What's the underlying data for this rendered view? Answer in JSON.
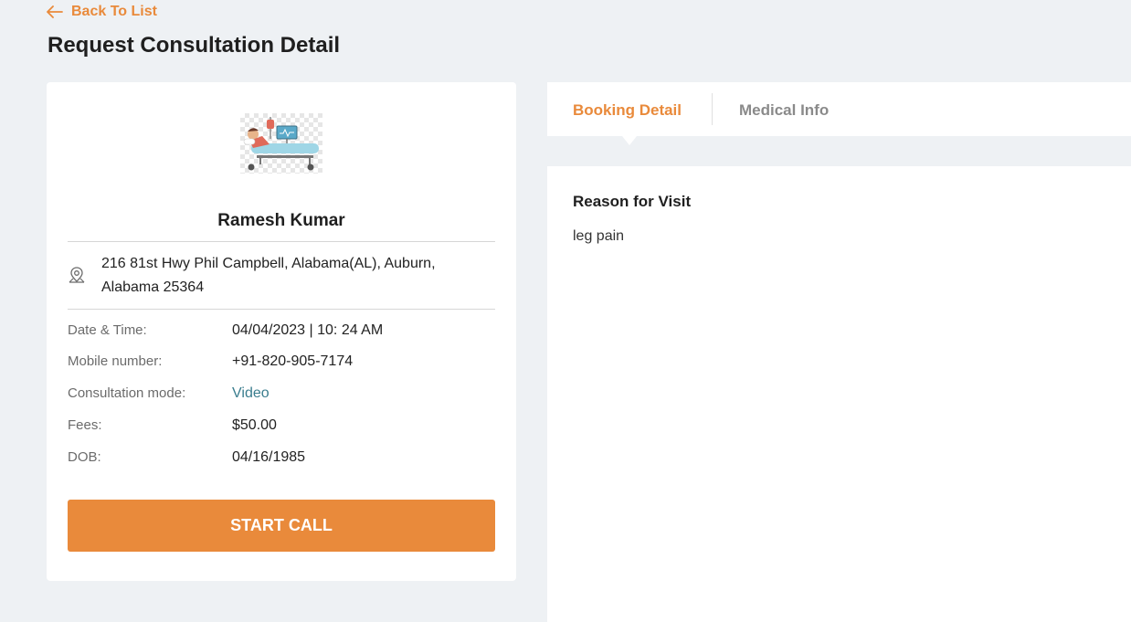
{
  "nav": {
    "back_label": "Back To List"
  },
  "page": {
    "title": "Request Consultation Detail"
  },
  "patient": {
    "name": "Ramesh Kumar",
    "address": "216 81st Hwy Phil Campbell, Alabama(AL), Auburn, Alabama 25364"
  },
  "details": {
    "date_time": {
      "label": "Date & Time:",
      "value": "04/04/2023 | 10: 24 AM"
    },
    "mobile": {
      "label": "Mobile number:",
      "value": "+91-820-905-7174"
    },
    "mode": {
      "label": "Consultation mode:",
      "value": "Video"
    },
    "fees": {
      "label": "Fees:",
      "value": "$50.00"
    },
    "dob": {
      "label": "DOB:",
      "value": "04/16/1985"
    }
  },
  "actions": {
    "start_call_label": "START CALL"
  },
  "tabs": [
    {
      "label": "Booking Detail",
      "active": true
    },
    {
      "label": "Medical Info",
      "active": false
    }
  ],
  "booking": {
    "reason_heading": "Reason for Visit",
    "reason_text": "leg pain"
  },
  "colors": {
    "accent": "#e98a3b",
    "link": "#3a7d8e",
    "background": "#eef1f4"
  },
  "icons": {
    "back": "arrow-left-icon",
    "address": "location-pin-icon",
    "avatar": "patient-bed-illustration"
  }
}
